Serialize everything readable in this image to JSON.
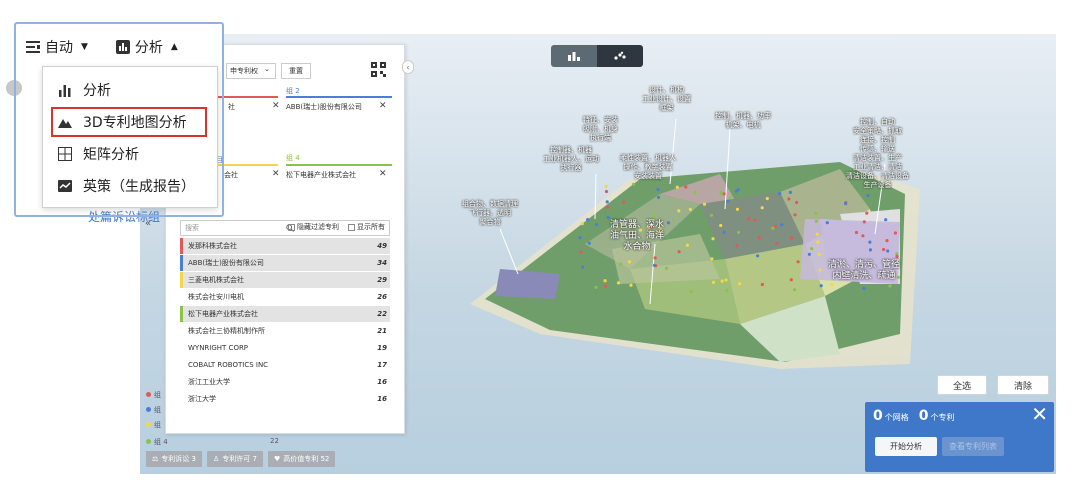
{
  "menubar": {
    "auto_label": "自动",
    "analysis_label": "分析"
  },
  "menu": {
    "items": [
      {
        "label": "分析",
        "icon": "bar-chart-icon"
      },
      {
        "label": "3D专利地图分析",
        "icon": "mountain-icon"
      },
      {
        "label": "矩阵分析",
        "icon": "grid-icon"
      },
      {
        "label": "英策（生成报告）",
        "icon": "report-icon"
      }
    ],
    "selected_index": 1
  },
  "panel": {
    "select_value": "申专利权",
    "reset_label": "重置",
    "groups": [
      {
        "title": "组 2",
        "company": "ABB(瑞士)股份有限公司",
        "color": "#4a7fd4"
      },
      {
        "title": "组 4",
        "company": "松下电器产业株式会社",
        "color": "#8ac24a"
      }
    ],
    "partial_company_1": "社",
    "partial_company_3": "会社",
    "partial_title_3": "目",
    "search_placeholder": "搜索",
    "hide_filtered_label": "隐藏过滤专利",
    "show_all_label": "显示所有",
    "companies": [
      {
        "name": "发那科株式会社",
        "count": "49",
        "color": "#e05a5a",
        "hl": true
      },
      {
        "name": "ABB(瑞士)股份有限公司",
        "count": "34",
        "color": "#4a7fd4",
        "hl": true
      },
      {
        "name": "三菱电机株式会社",
        "count": "29",
        "color": "#f0d84a",
        "hl": true
      },
      {
        "name": "株式会社安川电机",
        "count": "26",
        "color": "",
        "hl": false
      },
      {
        "name": "松下电器产业株式会社",
        "count": "22",
        "color": "#8ac24a",
        "hl": true
      },
      {
        "name": "株式会社三协精机制作所",
        "count": "21",
        "color": "",
        "hl": false
      },
      {
        "name": "WYNRIGHT CORP",
        "count": "19",
        "color": "",
        "hl": false
      },
      {
        "name": "COBALT ROBOTICS INC",
        "count": "17",
        "color": "",
        "hl": false
      },
      {
        "name": "浙江工业大学",
        "count": "16",
        "color": "",
        "hl": false
      },
      {
        "name": "浙江大学",
        "count": "16",
        "color": "",
        "hl": false
      }
    ]
  },
  "legend": {
    "group4_label": "组 4",
    "group4_count": "22",
    "dot_colors": [
      "#e05a5a",
      "#4a7fd4",
      "#f0d84a",
      "#8ac24a"
    ]
  },
  "stats": [
    {
      "label": "专利诉讼 3",
      "icon": "gavel-icon"
    },
    {
      "label": "专利许可 7",
      "icon": "ribbon-icon"
    },
    {
      "label": "高价值专利 52",
      "icon": "heart-icon"
    }
  ],
  "map": {
    "labels": [
      {
        "text": "设计、机构\n工业设计、设置\n框架"
      },
      {
        "text": "特征、安装\n吸附、机身\n执行端"
      },
      {
        "text": "控制器、机器\n工业机器人、运动\n执行器"
      },
      {
        "text": "柔性装置、机器人\n操作、教学装置\n安装装置"
      },
      {
        "text": "控制、机器、功率\n机架、电机"
      },
      {
        "text": "控制、自动\n安全策略、抓取\n连接、控制\n传感、输送\n清洁装置、生产\n工业清洁、清洁\n清洁设备、清洁设备\n生产设备"
      },
      {
        "text": "组合物、数据清理\n飞行器、透明\n聚合物"
      },
      {
        "text": "清管器、深水\n油气田、海洋\n水合物"
      },
      {
        "text": "清淤、清污、管径\n内壁清洗、疏通"
      }
    ],
    "select_all_label": "全选",
    "clear_label": "清除"
  },
  "action_panel": {
    "grid_count": "0",
    "grid_unit": "个网格",
    "patent_count": "0",
    "patent_unit": "个专利",
    "start_label": "开始分析",
    "list_label": "查看专利列表"
  },
  "partial_link": "处篇诉讼标组"
}
